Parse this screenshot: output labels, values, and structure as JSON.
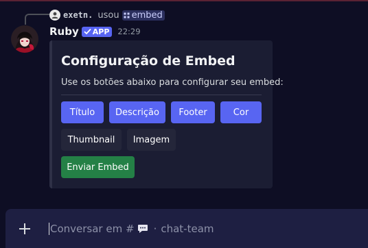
{
  "reply": {
    "username": "exetn.",
    "used_text": "usou",
    "command": "embed"
  },
  "message": {
    "username": "Ruby",
    "badge": "APP",
    "timestamp": "22:29"
  },
  "embed": {
    "title": "Configuração de Embed",
    "description": "Use os botões abaixo para configurar seu embed:",
    "buttons": [
      {
        "label": "Título",
        "style": "primary"
      },
      {
        "label": "Descrição",
        "style": "primary"
      },
      {
        "label": "Footer",
        "style": "primary"
      },
      {
        "label": "Cor",
        "style": "primary"
      },
      {
        "label": "Thumbnail",
        "style": "secondary"
      },
      {
        "label": "Imagem",
        "style": "secondary"
      },
      {
        "label": "Enviar Embed",
        "style": "success"
      }
    ]
  },
  "composer": {
    "placeholder_prefix": "Conversar em #",
    "channel": "chat-team"
  },
  "colors": {
    "background": "#0e0e24",
    "blurple": "#5865f2",
    "success": "#248046",
    "secondary": "#24263a"
  },
  "icons": {
    "reply_avatar": "user-avatar-icon",
    "command": "slash-command-icon",
    "badge": "verified-check-icon",
    "plus": "plus-icon",
    "channel": "speech-bubble-icon"
  }
}
